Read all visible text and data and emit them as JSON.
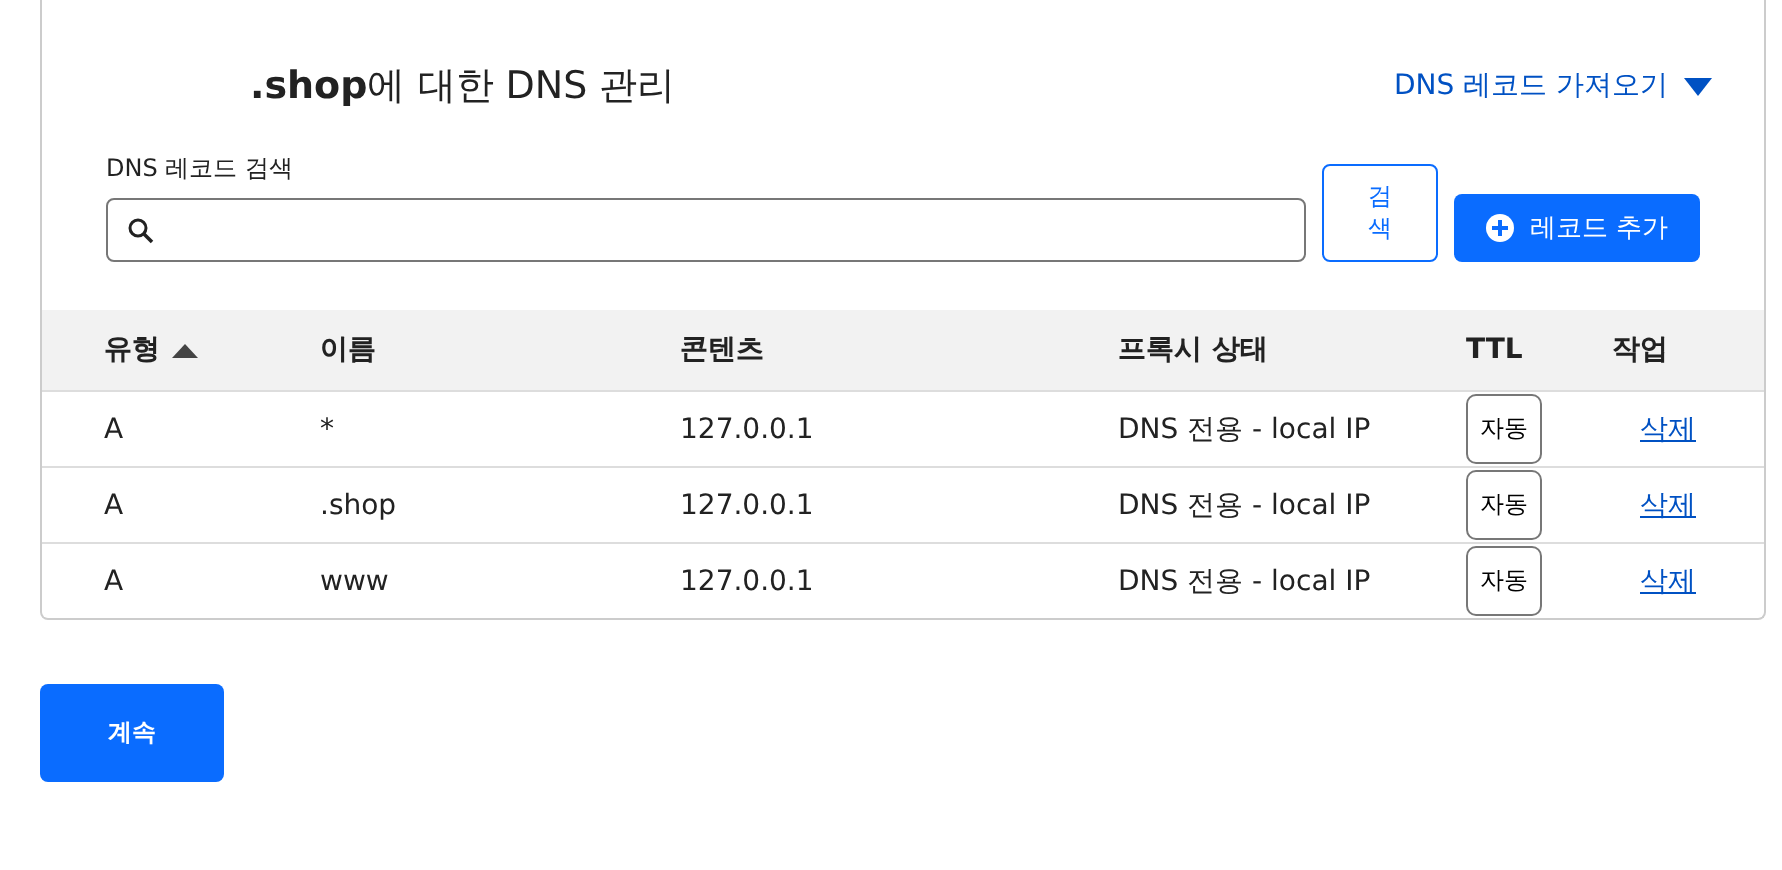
{
  "title": "**.shop**에 대한 DNS 관리",
  "import_link": "DNS 레코드 가져오기",
  "search": {
    "label": "DNS 레코드 검색",
    "button": "검색"
  },
  "add_button": "레코드 추가",
  "table": {
    "columns": [
      {
        "label": "유형",
        "sorted": true
      },
      {
        "label": "이름",
        "sorted": false
      },
      {
        "label": "콘텐츠",
        "sorted": false
      },
      {
        "label": "프록시 상태",
        "sorted": false
      },
      {
        "label": "TTL",
        "sorted": false
      },
      {
        "label": "작업",
        "sorted": false
      }
    ],
    "rows": [
      {
        "type": "A",
        "name": "*",
        "content": "127.0.0.1",
        "proxy": "DNS 전용 - local IP",
        "ttl": "자동",
        "action": "삭제"
      },
      {
        "type": "A",
        "name": ".shop",
        "content": "127.0.0.1",
        "proxy": "DNS 전용 - local IP",
        "ttl": "자동",
        "action": "삭제"
      },
      {
        "type": "A",
        "name": "www",
        "content": "127.0.0.1",
        "proxy": "DNS 전용 - local IP",
        "ttl": "자동",
        "action": "삭제"
      }
    ]
  },
  "continue_button": "계속"
}
